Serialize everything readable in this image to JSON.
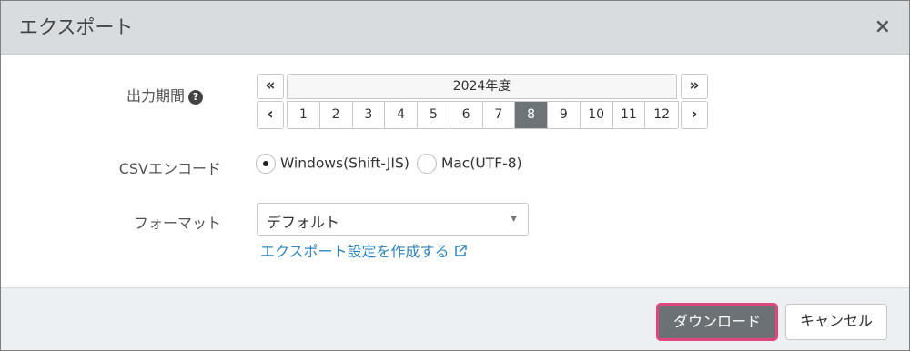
{
  "dialog": {
    "title": "エクスポート",
    "close_label": "×"
  },
  "period": {
    "label": "出力期間",
    "help_icon": "question-circle-icon",
    "prev_year": "«",
    "next_year": "»",
    "prev_month": "‹",
    "next_month": "›",
    "fiscal_year": "2024年度",
    "months": [
      "1",
      "2",
      "3",
      "4",
      "5",
      "6",
      "7",
      "8",
      "9",
      "10",
      "11",
      "12"
    ],
    "selected_month": "8"
  },
  "encoding": {
    "label": "CSVエンコード",
    "options": [
      {
        "label": "Windows(Shift-JIS)",
        "checked": true
      },
      {
        "label": "Mac(UTF-8)",
        "checked": false
      }
    ]
  },
  "format": {
    "label": "フォーマット",
    "selected": "デフォルト",
    "create_link": "エクスポート設定を作成する"
  },
  "footer": {
    "download_label": "ダウンロード",
    "cancel_label": "キャンセル"
  },
  "colors": {
    "header_bg": "#d9dcdf",
    "active_month": "#6d7478",
    "link": "#2f86c1",
    "focus_ring": "#e0457b"
  }
}
